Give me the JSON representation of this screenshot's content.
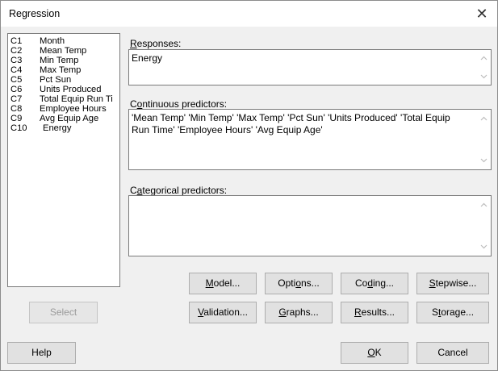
{
  "dialog": {
    "title": "Regression",
    "close_symbol": "✕"
  },
  "variables": [
    {
      "id": "C1",
      "name": "Month"
    },
    {
      "id": "C2",
      "name": "Mean Temp"
    },
    {
      "id": "C3",
      "name": "Min Temp"
    },
    {
      "id": "C4",
      "name": "Max Temp"
    },
    {
      "id": "C5",
      "name": "Pct Sun"
    },
    {
      "id": "C6",
      "name": "Units Produced"
    },
    {
      "id": "C7",
      "name": "Total Equip Run Ti"
    },
    {
      "id": "C8",
      "name": "Employee Hours"
    },
    {
      "id": "C9",
      "name": "Avg Equip Age"
    },
    {
      "id": "C10",
      "name": "Energy"
    }
  ],
  "responses": {
    "label_pre": "",
    "label_key": "R",
    "label_post": "esponses:",
    "value": "Energy"
  },
  "continuous": {
    "label_pre": "C",
    "label_key": "o",
    "label_post": "ntinuous predictors:",
    "value": "'Mean Temp' 'Min Temp' 'Max Temp' 'Pct Sun' 'Units Produced' 'Total Equip Run Time' 'Employee Hours' 'Avg Equip Age'"
  },
  "categorical": {
    "label_pre": "C",
    "label_key": "a",
    "label_post": "tegorical predictors:",
    "value": ""
  },
  "buttons": {
    "select": "Select",
    "help": "Help",
    "model": {
      "pre": "",
      "key": "M",
      "post": "odel..."
    },
    "options": {
      "pre": "Opti",
      "key": "o",
      "post": "ns..."
    },
    "coding": {
      "pre": "Co",
      "key": "d",
      "post": "ing..."
    },
    "stepwise": {
      "pre": "",
      "key": "S",
      "post": "tepwise..."
    },
    "validation": {
      "pre": "",
      "key": "V",
      "post": "alidation..."
    },
    "graphs": {
      "pre": "",
      "key": "G",
      "post": "raphs..."
    },
    "results": {
      "pre": "",
      "key": "R",
      "post": "esults..."
    },
    "storage": {
      "pre": "S",
      "key": "t",
      "post": "orage..."
    },
    "ok": {
      "pre": "",
      "key": "O",
      "post": "K"
    },
    "cancel": "Cancel"
  }
}
